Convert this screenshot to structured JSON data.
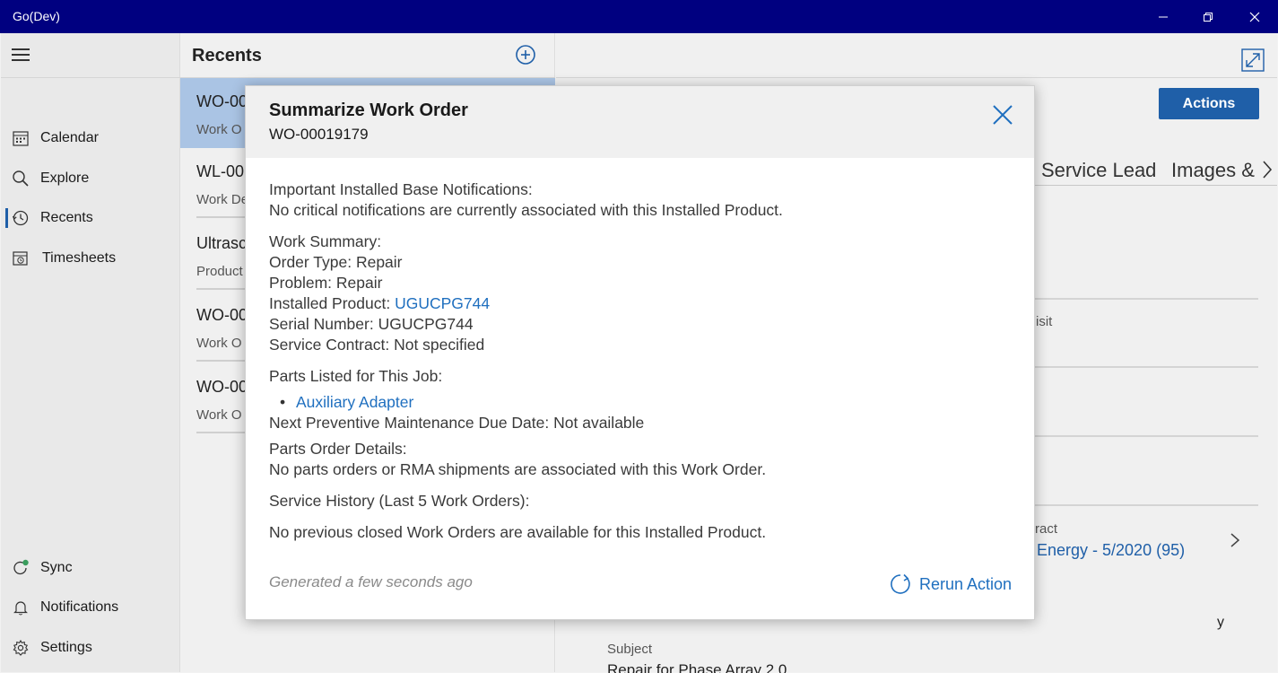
{
  "window": {
    "title": "Go(Dev)"
  },
  "nav": {
    "items": [
      {
        "label": "Calendar"
      },
      {
        "label": "Explore"
      },
      {
        "label": "Recents"
      },
      {
        "label": "Timesheets"
      }
    ],
    "bottom_items": [
      {
        "label": "Sync"
      },
      {
        "label": "Notifications"
      },
      {
        "label": "Settings"
      }
    ]
  },
  "recents": {
    "title": "Recents",
    "rows": [
      {
        "line1": "WO-00",
        "line2": "Work O"
      },
      {
        "line1": "WL-00",
        "line2": "Work De"
      },
      {
        "line1": "Ultrasc",
        "line2": "Product"
      },
      {
        "line1": "WO-00",
        "line2": "Work O"
      },
      {
        "line1": "WO-00",
        "line2": "Work O"
      }
    ]
  },
  "detail": {
    "actions_label": "Actions",
    "tabs": {
      "service_lead": "Service Lead",
      "images": "Images &"
    },
    "visit_fragment": "isit",
    "ract_fragment": "ract",
    "energy_fragment": "Energy - 5/2020 (95)",
    "y_fragment": "y",
    "subject_label": "Subject",
    "subject_value": "Repair for Phase Array 2.0"
  },
  "modal": {
    "title": "Summarize Work Order",
    "subtitle": "WO-00019179",
    "notifications_heading": "Important Installed Base Notifications:",
    "notifications_text": "No critical notifications are currently associated with this Installed Product.",
    "work_summary_heading": "Work Summary:",
    "order_type": "Order Type: Repair",
    "problem": "Problem: Repair",
    "installed_product_label": "Installed Product: ",
    "installed_product_link": "UGUCPG744",
    "serial_number": "Serial Number: UGUCPG744",
    "service_contract": "Service Contract: Not specified",
    "parts_heading": "Parts Listed for This Job:",
    "parts": [
      "Auxiliary Adapter"
    ],
    "next_pm": "Next Preventive Maintenance Due Date: Not available",
    "parts_order_heading": "Parts Order Details:",
    "parts_order_text": "No parts orders or RMA shipments are associated with this Work Order.",
    "service_history_heading": "Service History (Last 5 Work Orders):",
    "service_history_text": "No previous closed Work Orders are available for this Installed Product.",
    "generated": "Generated a few seconds ago",
    "rerun_label": "Rerun Action"
  },
  "colors": {
    "titlebar": "#000080",
    "accent": "#1f5fa8",
    "link": "#1f6fbf",
    "selected_row": "#aac4e4"
  }
}
